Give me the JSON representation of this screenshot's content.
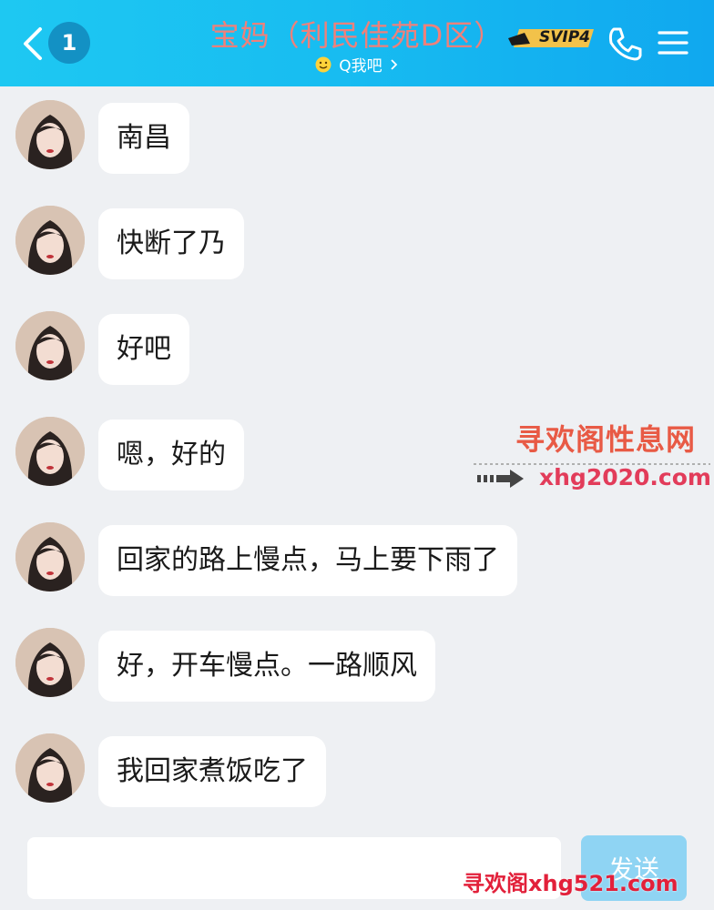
{
  "header": {
    "unread_count": "1",
    "title": "宝妈（利民佳苑D区）",
    "subtitle": "Q我吧",
    "vip_badge": "SVIP4",
    "icons": [
      "back-arrow-icon",
      "smile-icon",
      "phone-icon",
      "menu-icon"
    ]
  },
  "messages": [
    {
      "text": "南昌"
    },
    {
      "text": "快断了乃"
    },
    {
      "text": "好吧"
    },
    {
      "text": "嗯，好的"
    },
    {
      "text": "回家的路上慢点，马上要下雨了"
    },
    {
      "text": "好，开车慢点。一路顺风"
    },
    {
      "text": "我回家煮饭吃了"
    }
  ],
  "watermark": {
    "title": "寻欢阁性息网",
    "url": "xhg2020.com",
    "bottom": "寻欢阁xhg521.com"
  },
  "input": {
    "value": "",
    "send_label": "发送"
  },
  "colors": {
    "header_start": "#1ec8f2",
    "header_end": "#10a8ef",
    "title": "#f0807a",
    "send_button": "#8fd4f3",
    "background": "#eef0f3"
  }
}
